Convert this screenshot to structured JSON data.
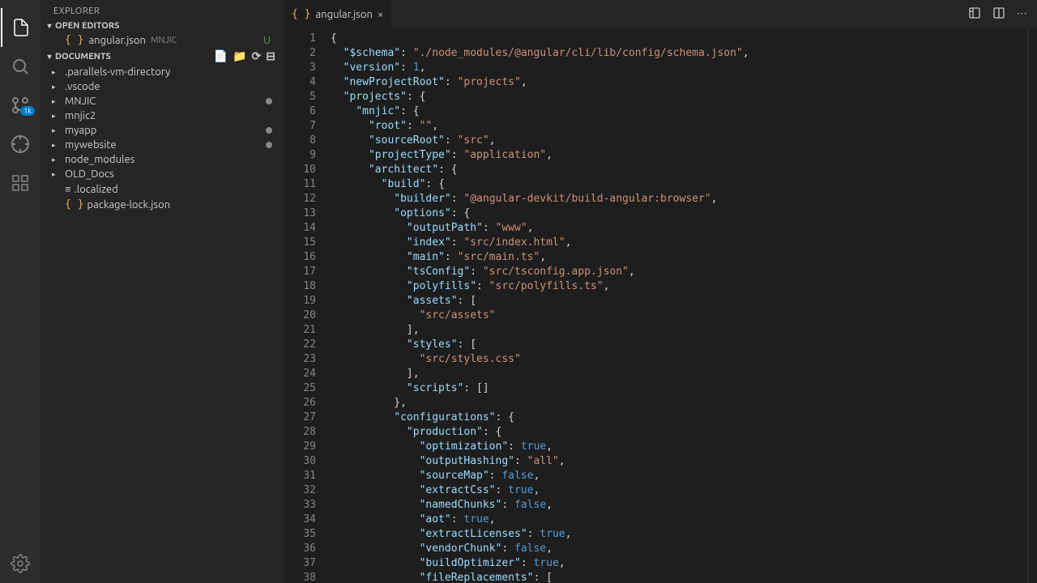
{
  "explorer": {
    "title": "EXPLORER",
    "openEditors": {
      "label": "OPEN EDITORS",
      "item": {
        "name": "angular.json",
        "tag": "MNJIC",
        "status": "U"
      }
    },
    "workspace": {
      "label": "DOCUMENTS",
      "items": [
        {
          "name": ".parallels-vm-directory",
          "type": "folder"
        },
        {
          "name": ".vscode",
          "type": "folder"
        },
        {
          "name": "MNJIC",
          "type": "folder",
          "modified": true
        },
        {
          "name": "mnjic2",
          "type": "folder"
        },
        {
          "name": "myapp",
          "type": "folder",
          "modified": true
        },
        {
          "name": "mywebsite",
          "type": "folder",
          "modified": true
        },
        {
          "name": "node_modules",
          "type": "folder"
        },
        {
          "name": "OLD_Docs",
          "type": "folder"
        },
        {
          "name": ".localized",
          "type": "file-text"
        },
        {
          "name": "package-lock.json",
          "type": "file-json"
        }
      ]
    }
  },
  "tab": {
    "name": "angular.json"
  },
  "scm_badge": "1k",
  "code": [
    {
      "i": 0,
      "t": "brace",
      "s": "{"
    },
    {
      "i": 1,
      "parts": [
        {
          "t": "key",
          "s": "\"$schema\""
        },
        {
          "t": "colon",
          "s": ": "
        },
        {
          "t": "str",
          "s": "\"./node_modules/@angular/cli/lib/config/schema.json\""
        },
        {
          "t": "brace",
          "s": ","
        }
      ]
    },
    {
      "i": 1,
      "parts": [
        {
          "t": "key",
          "s": "\"version\""
        },
        {
          "t": "colon",
          "s": ": "
        },
        {
          "t": "num",
          "s": "1"
        },
        {
          "t": "brace",
          "s": ","
        }
      ]
    },
    {
      "i": 1,
      "parts": [
        {
          "t": "key",
          "s": "\"newProjectRoot\""
        },
        {
          "t": "colon",
          "s": ": "
        },
        {
          "t": "str",
          "s": "\"projects\""
        },
        {
          "t": "brace",
          "s": ","
        }
      ]
    },
    {
      "i": 1,
      "parts": [
        {
          "t": "key",
          "s": "\"projects\""
        },
        {
          "t": "colon",
          "s": ": "
        },
        {
          "t": "brace",
          "s": "{"
        }
      ]
    },
    {
      "i": 2,
      "parts": [
        {
          "t": "key",
          "s": "\"mnjic\""
        },
        {
          "t": "colon",
          "s": ": "
        },
        {
          "t": "brace",
          "s": "{"
        }
      ]
    },
    {
      "i": 3,
      "parts": [
        {
          "t": "key",
          "s": "\"root\""
        },
        {
          "t": "colon",
          "s": ": "
        },
        {
          "t": "str",
          "s": "\"\""
        },
        {
          "t": "brace",
          "s": ","
        }
      ]
    },
    {
      "i": 3,
      "parts": [
        {
          "t": "key",
          "s": "\"sourceRoot\""
        },
        {
          "t": "colon",
          "s": ": "
        },
        {
          "t": "str",
          "s": "\"src\""
        },
        {
          "t": "brace",
          "s": ","
        }
      ]
    },
    {
      "i": 3,
      "parts": [
        {
          "t": "key",
          "s": "\"projectType\""
        },
        {
          "t": "colon",
          "s": ": "
        },
        {
          "t": "str",
          "s": "\"application\""
        },
        {
          "t": "brace",
          "s": ","
        }
      ]
    },
    {
      "i": 3,
      "parts": [
        {
          "t": "key",
          "s": "\"architect\""
        },
        {
          "t": "colon",
          "s": ": "
        },
        {
          "t": "brace",
          "s": "{"
        }
      ]
    },
    {
      "i": 4,
      "parts": [
        {
          "t": "key",
          "s": "\"build\""
        },
        {
          "t": "colon",
          "s": ": "
        },
        {
          "t": "brace",
          "s": "{"
        }
      ]
    },
    {
      "i": 5,
      "parts": [
        {
          "t": "key",
          "s": "\"builder\""
        },
        {
          "t": "colon",
          "s": ": "
        },
        {
          "t": "str",
          "s": "\"@angular-devkit/build-angular:browser\""
        },
        {
          "t": "brace",
          "s": ","
        }
      ]
    },
    {
      "i": 5,
      "parts": [
        {
          "t": "key",
          "s": "\"options\""
        },
        {
          "t": "colon",
          "s": ": "
        },
        {
          "t": "brace",
          "s": "{"
        }
      ]
    },
    {
      "i": 6,
      "parts": [
        {
          "t": "key",
          "s": "\"outputPath\""
        },
        {
          "t": "colon",
          "s": ": "
        },
        {
          "t": "str",
          "s": "\"www\""
        },
        {
          "t": "brace",
          "s": ","
        }
      ]
    },
    {
      "i": 6,
      "parts": [
        {
          "t": "key",
          "s": "\"index\""
        },
        {
          "t": "colon",
          "s": ": "
        },
        {
          "t": "str",
          "s": "\"src/index.html\""
        },
        {
          "t": "brace",
          "s": ","
        }
      ]
    },
    {
      "i": 6,
      "parts": [
        {
          "t": "key",
          "s": "\"main\""
        },
        {
          "t": "colon",
          "s": ": "
        },
        {
          "t": "str",
          "s": "\"src/main.ts\""
        },
        {
          "t": "brace",
          "s": ","
        }
      ]
    },
    {
      "i": 6,
      "parts": [
        {
          "t": "key",
          "s": "\"tsConfig\""
        },
        {
          "t": "colon",
          "s": ": "
        },
        {
          "t": "str",
          "s": "\"src/tsconfig.app.json\""
        },
        {
          "t": "brace",
          "s": ","
        }
      ]
    },
    {
      "i": 6,
      "parts": [
        {
          "t": "key",
          "s": "\"polyfills\""
        },
        {
          "t": "colon",
          "s": ": "
        },
        {
          "t": "str",
          "s": "\"src/polyfills.ts\""
        },
        {
          "t": "brace",
          "s": ","
        }
      ]
    },
    {
      "i": 6,
      "parts": [
        {
          "t": "key",
          "s": "\"assets\""
        },
        {
          "t": "colon",
          "s": ": "
        },
        {
          "t": "brace",
          "s": "["
        }
      ]
    },
    {
      "i": 7,
      "parts": [
        {
          "t": "str",
          "s": "\"src/assets\""
        }
      ]
    },
    {
      "i": 6,
      "parts": [
        {
          "t": "brace",
          "s": "],"
        }
      ]
    },
    {
      "i": 6,
      "parts": [
        {
          "t": "key",
          "s": "\"styles\""
        },
        {
          "t": "colon",
          "s": ": "
        },
        {
          "t": "brace",
          "s": "["
        }
      ]
    },
    {
      "i": 7,
      "parts": [
        {
          "t": "str",
          "s": "\"src/styles.css\""
        }
      ]
    },
    {
      "i": 6,
      "parts": [
        {
          "t": "brace",
          "s": "],"
        }
      ]
    },
    {
      "i": 6,
      "parts": [
        {
          "t": "key",
          "s": "\"scripts\""
        },
        {
          "t": "colon",
          "s": ": "
        },
        {
          "t": "brace",
          "s": "[]"
        }
      ]
    },
    {
      "i": 5,
      "parts": [
        {
          "t": "brace",
          "s": "},"
        }
      ]
    },
    {
      "i": 5,
      "parts": [
        {
          "t": "key",
          "s": "\"configurations\""
        },
        {
          "t": "colon",
          "s": ": "
        },
        {
          "t": "brace",
          "s": "{"
        }
      ]
    },
    {
      "i": 6,
      "parts": [
        {
          "t": "key",
          "s": "\"production\""
        },
        {
          "t": "colon",
          "s": ": "
        },
        {
          "t": "brace",
          "s": "{"
        }
      ]
    },
    {
      "i": 7,
      "parts": [
        {
          "t": "key",
          "s": "\"optimization\""
        },
        {
          "t": "colon",
          "s": ": "
        },
        {
          "t": "bool",
          "s": "true"
        },
        {
          "t": "brace",
          "s": ","
        }
      ]
    },
    {
      "i": 7,
      "parts": [
        {
          "t": "key",
          "s": "\"outputHashing\""
        },
        {
          "t": "colon",
          "s": ": "
        },
        {
          "t": "str",
          "s": "\"all\""
        },
        {
          "t": "brace",
          "s": ","
        }
      ]
    },
    {
      "i": 7,
      "parts": [
        {
          "t": "key",
          "s": "\"sourceMap\""
        },
        {
          "t": "colon",
          "s": ": "
        },
        {
          "t": "bool",
          "s": "false"
        },
        {
          "t": "brace",
          "s": ","
        }
      ]
    },
    {
      "i": 7,
      "parts": [
        {
          "t": "key",
          "s": "\"extractCss\""
        },
        {
          "t": "colon",
          "s": ": "
        },
        {
          "t": "bool",
          "s": "true"
        },
        {
          "t": "brace",
          "s": ","
        }
      ]
    },
    {
      "i": 7,
      "parts": [
        {
          "t": "key",
          "s": "\"namedChunks\""
        },
        {
          "t": "colon",
          "s": ": "
        },
        {
          "t": "bool",
          "s": "false"
        },
        {
          "t": "brace",
          "s": ","
        }
      ]
    },
    {
      "i": 7,
      "parts": [
        {
          "t": "key",
          "s": "\"aot\""
        },
        {
          "t": "colon",
          "s": ": "
        },
        {
          "t": "bool",
          "s": "true"
        },
        {
          "t": "brace",
          "s": ","
        }
      ]
    },
    {
      "i": 7,
      "parts": [
        {
          "t": "key",
          "s": "\"extractLicenses\""
        },
        {
          "t": "colon",
          "s": ": "
        },
        {
          "t": "bool",
          "s": "true"
        },
        {
          "t": "brace",
          "s": ","
        }
      ]
    },
    {
      "i": 7,
      "parts": [
        {
          "t": "key",
          "s": "\"vendorChunk\""
        },
        {
          "t": "colon",
          "s": ": "
        },
        {
          "t": "bool",
          "s": "false"
        },
        {
          "t": "brace",
          "s": ","
        }
      ]
    },
    {
      "i": 7,
      "parts": [
        {
          "t": "key",
          "s": "\"buildOptimizer\""
        },
        {
          "t": "colon",
          "s": ": "
        },
        {
          "t": "bool",
          "s": "true"
        },
        {
          "t": "brace",
          "s": ","
        }
      ]
    },
    {
      "i": 7,
      "parts": [
        {
          "t": "key",
          "s": "\"fileReplacements\""
        },
        {
          "t": "colon",
          "s": ": "
        },
        {
          "t": "brace",
          "s": "["
        }
      ]
    }
  ]
}
